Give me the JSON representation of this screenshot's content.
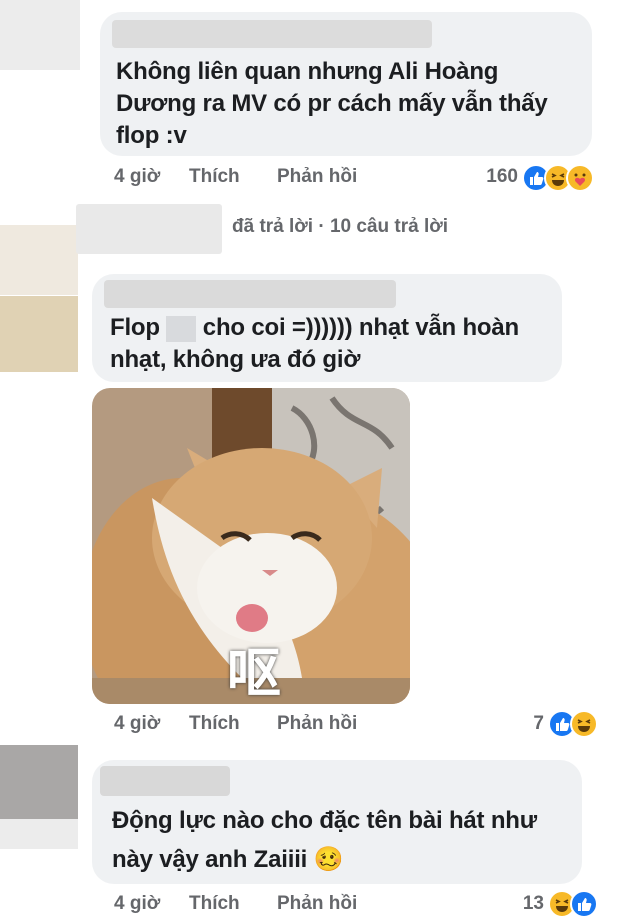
{
  "comments": [
    {
      "text_lines": [
        "Không liên quan nhưng Ali Hoàng",
        "Dương ra MV có pr cách mấy vẫn thấy",
        "flop :v"
      ],
      "time": "4 giờ",
      "like_label": "Thích",
      "reply_label": "Phản hồi",
      "reaction_count": "160",
      "reactions": [
        "like-reaction-icon",
        "haha-reaction-icon",
        "care-reaction-icon"
      ]
    },
    {
      "text_lines": [
        "Flop",
        "cho coi =)))))) nhạt vẫn hoàn",
        "nhạt, không ưa đó giờ"
      ],
      "time": "4 giờ",
      "like_label": "Thích",
      "reply_label": "Phản hồi",
      "reaction_count": "7",
      "reactions": [
        "like-reaction-icon",
        "haha-reaction-icon"
      ],
      "sticker_caption": "呕"
    },
    {
      "text_lines": [
        "Động lực nào cho đặc tên bài hát như",
        "này vậy anh Zaiiii"
      ],
      "emoji": "🥴",
      "time": "4 giờ",
      "like_label": "Thích",
      "reply_label": "Phản hồi",
      "reaction_count": "13",
      "reactions": [
        "haha-reaction-icon",
        "like-reaction-icon"
      ]
    }
  ],
  "replies_summary": {
    "replied": "đã trả lời",
    "separator": "·",
    "count_label": "10 câu trả lời"
  },
  "colors": {
    "bubble": "#eff1f3",
    "meta_text": "#65676b",
    "like_blue": "#1877f2",
    "haha_yellow": "#f7b928"
  }
}
